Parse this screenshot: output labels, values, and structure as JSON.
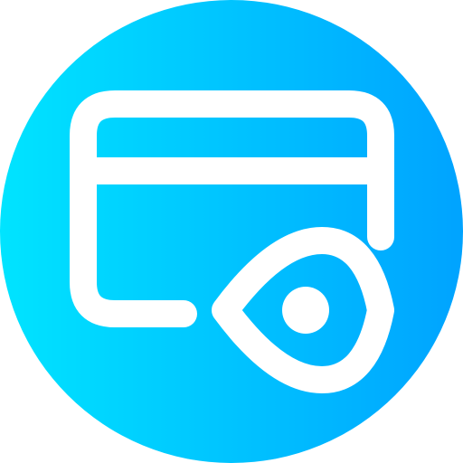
{
  "icon": {
    "name": "card-view-icon",
    "gradient": {
      "start": "#00E4FF",
      "end": "#00A3FF"
    },
    "stroke_color": "#FFFFFF",
    "parts": [
      "circle-background",
      "credit-card-icon",
      "eye-icon"
    ]
  }
}
